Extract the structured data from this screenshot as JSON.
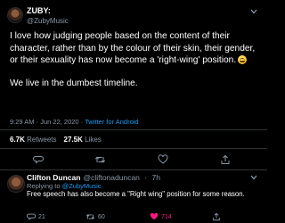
{
  "tweet": {
    "author_name": "ZUBY:",
    "author_handle": "@ZubyMusic",
    "paragraph1": "I love how judging people based on the content of their character, rather than by the colour of their skin, their gender, or their sexuality has now become a 'right-wing' position.",
    "paragraph2": "We live in the dumbest timeline.",
    "time": "9:29 AM",
    "date": "Jun 22, 2020",
    "separator": "·",
    "source": "Twitter for Android",
    "retweets_count": "6.7K",
    "retweets_label": "Retweets",
    "likes_count": "27.5K",
    "likes_label": "Likes",
    "emoji_icon": "laughing-face-emoji"
  },
  "reply": {
    "author_name": "Clifton Duncan",
    "author_handle": "@cliftonaduncan",
    "age": "7h",
    "separator": "·",
    "replying_to_label": "Replying to",
    "replying_to_handle": "@ZubyMusic",
    "text": "Free speech has also become a \"Right wing\" position for some reason.",
    "reply_count": "21",
    "retweet_count": "60",
    "like_count": "714",
    "like_color": "#f91880"
  },
  "colors": {
    "background": "#000000",
    "divider": "#2f3336",
    "accent": "#1d9bf0",
    "muted": "#8b98a5",
    "text": "#ffffff"
  }
}
